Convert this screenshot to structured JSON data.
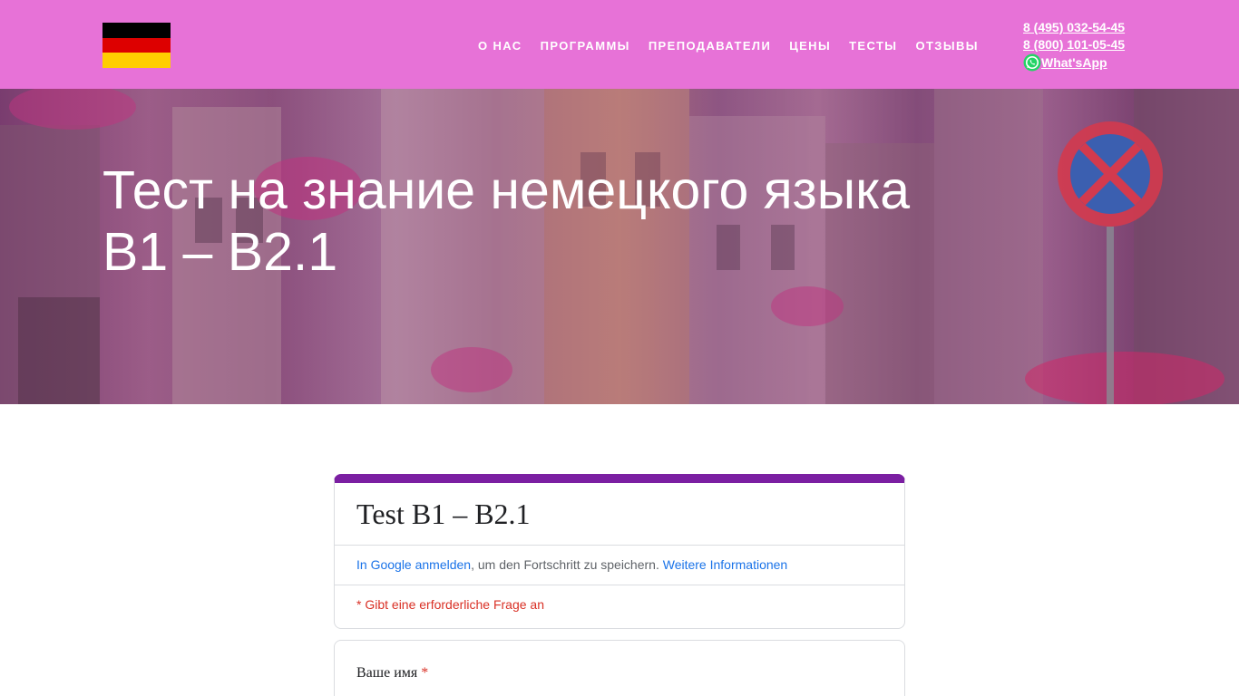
{
  "header": {
    "flag_colors": [
      "#000000",
      "#dd0000",
      "#ffce00"
    ],
    "nav": [
      {
        "label": "О НАС"
      },
      {
        "label": "ПРОГРАММЫ"
      },
      {
        "label": "ПРЕПОДАВАТЕЛИ"
      },
      {
        "label": "ЦЕНЫ"
      },
      {
        "label": "ТЕСТЫ"
      },
      {
        "label": "ОТЗЫВЫ"
      }
    ],
    "phone1": "8 (495) 032-54-45",
    "phone2": "8 (800) 101-05-45",
    "whatsapp": "What'sApp",
    "whatsapp_icon": "whatsapp-icon",
    "bg_color": "#e772d7"
  },
  "hero": {
    "title_line1": "Тест на знание немецкого языка",
    "title_line2": "B1 – B2.1"
  },
  "form": {
    "accent_color": "#7b1fa2",
    "title": "Test B1 – B2.1",
    "signin_link": "In Google anmelden",
    "signin_text": ", um den Fortschritt zu speichern. ",
    "more_info_link": "Weitere Informationen",
    "required_note": "* Gibt eine erforderliche Frage an",
    "question1": "Ваше имя",
    "required_star": "*"
  }
}
